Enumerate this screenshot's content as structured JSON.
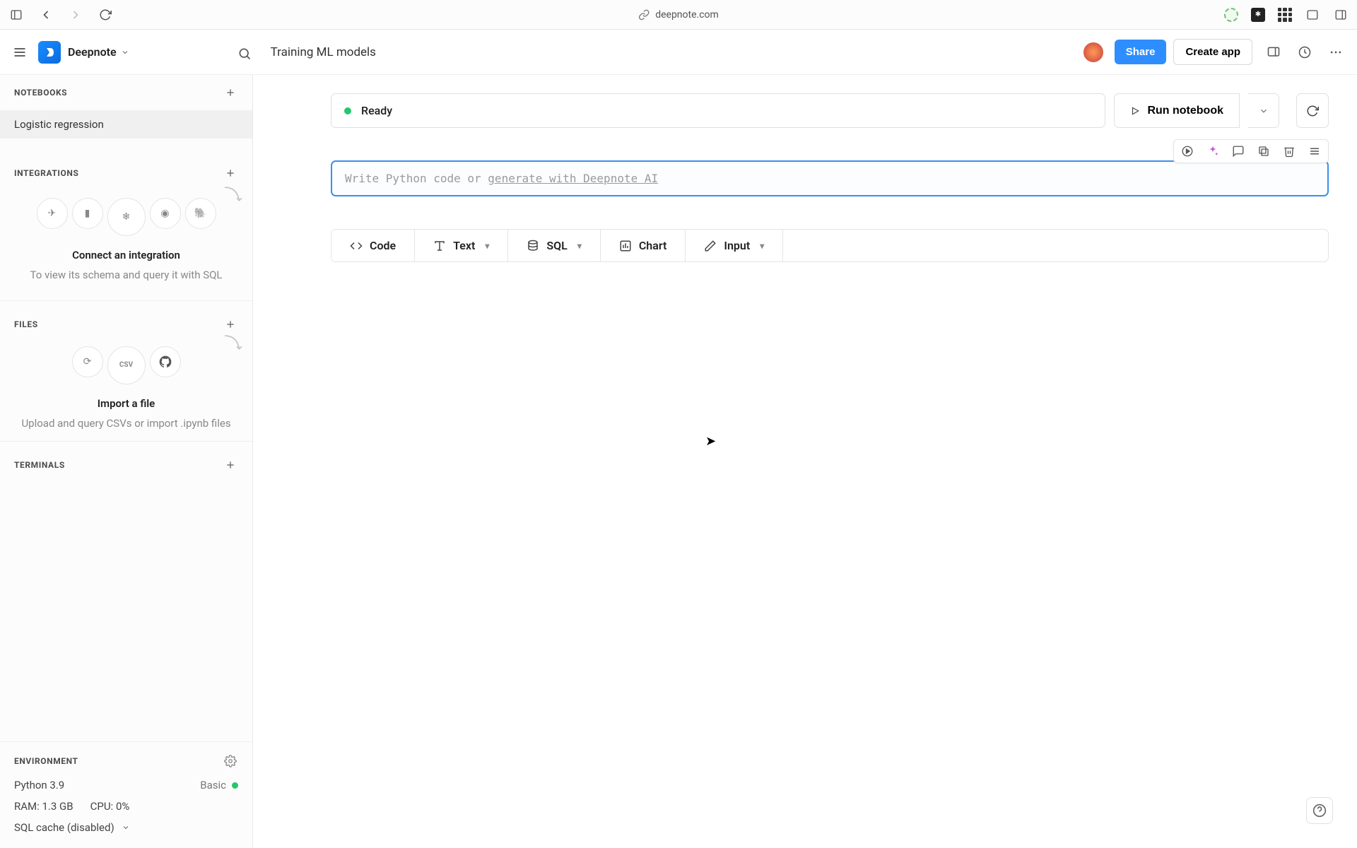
{
  "browser": {
    "url": "deepnote.com"
  },
  "workspace": "Deepnote",
  "project_title": "Training ML models",
  "topbar": {
    "share": "Share",
    "create_app": "Create app"
  },
  "sidebar": {
    "notebooks": {
      "header": "NOTEBOOKS",
      "items": [
        "Logistic regression"
      ]
    },
    "integrations": {
      "header": "INTEGRATIONS",
      "title": "Connect an integration",
      "sub": "To view its schema and query it with SQL"
    },
    "files": {
      "header": "FILES",
      "title": "Import a file",
      "sub": "Upload and query CSVs or import .ipynb files"
    },
    "terminals": {
      "header": "TERMINALS"
    }
  },
  "environment": {
    "header": "ENVIRONMENT",
    "python": "Python 3.9",
    "tier": "Basic",
    "ram_label": "RAM:",
    "ram_value": "1.3 GB",
    "cpu_label": "CPU:",
    "cpu_value": "0%",
    "sql_cache": "SQL cache (disabled)"
  },
  "main": {
    "status": "Ready",
    "run_label": "Run notebook",
    "placeholder_prefix": "Write Python code or ",
    "placeholder_ai": "generate with Deepnote AI",
    "blocks": {
      "code": "Code",
      "text": "Text",
      "sql": "SQL",
      "chart": "Chart",
      "input": "Input"
    }
  }
}
